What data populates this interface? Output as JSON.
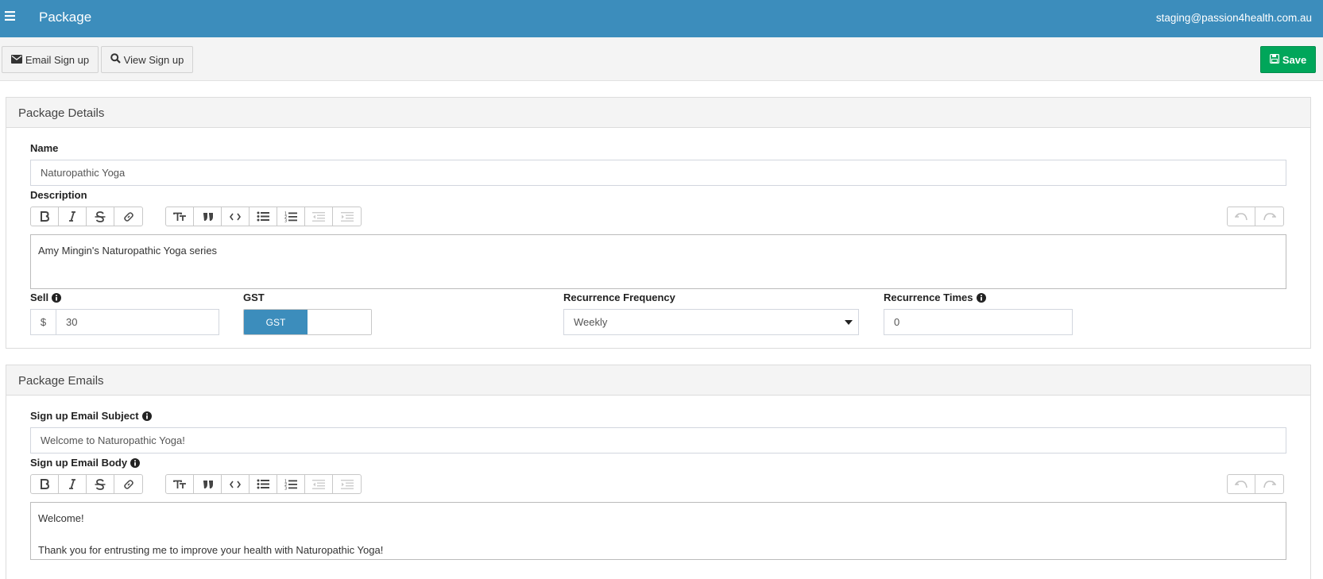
{
  "navbar": {
    "menu_icon": "hamburger-icon",
    "title": "Package",
    "user_email": "staging@passion4health.com.au"
  },
  "toolbar": {
    "email_signup": {
      "label": "Email Sign up",
      "icon": "envelope-icon"
    },
    "view_signup": {
      "label": "View Sign up",
      "icon": "search-icon"
    },
    "save": {
      "label": "Save",
      "icon": "floppy-disk-icon"
    }
  },
  "package_details": {
    "heading": "Package Details",
    "name_label": "Name",
    "name_value": "Naturopathic Yoga",
    "description_label": "Description",
    "description_value": "Amy Mingin's Naturopathic Yoga series",
    "sell_label": "Sell",
    "sell_currency": "$",
    "sell_value": "30",
    "gst_label": "GST",
    "gst_toggle_label": "GST",
    "recurrence_frequency_label": "Recurrence Frequency",
    "recurrence_frequency_value": "Weekly",
    "recurrence_times_label": "Recurrence Times",
    "recurrence_times_value": "0"
  },
  "package_emails": {
    "heading": "Package Emails",
    "subject_label": "Sign up Email Subject",
    "subject_value": "Welcome to Naturopathic Yoga!",
    "body_label": "Sign up Email Body",
    "body_line1": "Welcome!",
    "body_line2": "Thank you for entrusting me to improve your health with Naturopathic Yoga!"
  },
  "editor_toolbar": {
    "group1": [
      "bold-icon",
      "italic-icon",
      "strikethrough-icon",
      "link-icon"
    ],
    "group2": [
      "heading-icon",
      "quote-icon",
      "code-icon",
      "bullet-list-icon",
      "numbered-list-icon",
      "outdent-icon",
      "indent-icon"
    ],
    "group3": [
      "undo-icon",
      "redo-icon"
    ]
  },
  "colors": {
    "navbar": "#3c8dbc",
    "save_button": "#00a65a",
    "toggle_on": "#3c8dbc"
  }
}
